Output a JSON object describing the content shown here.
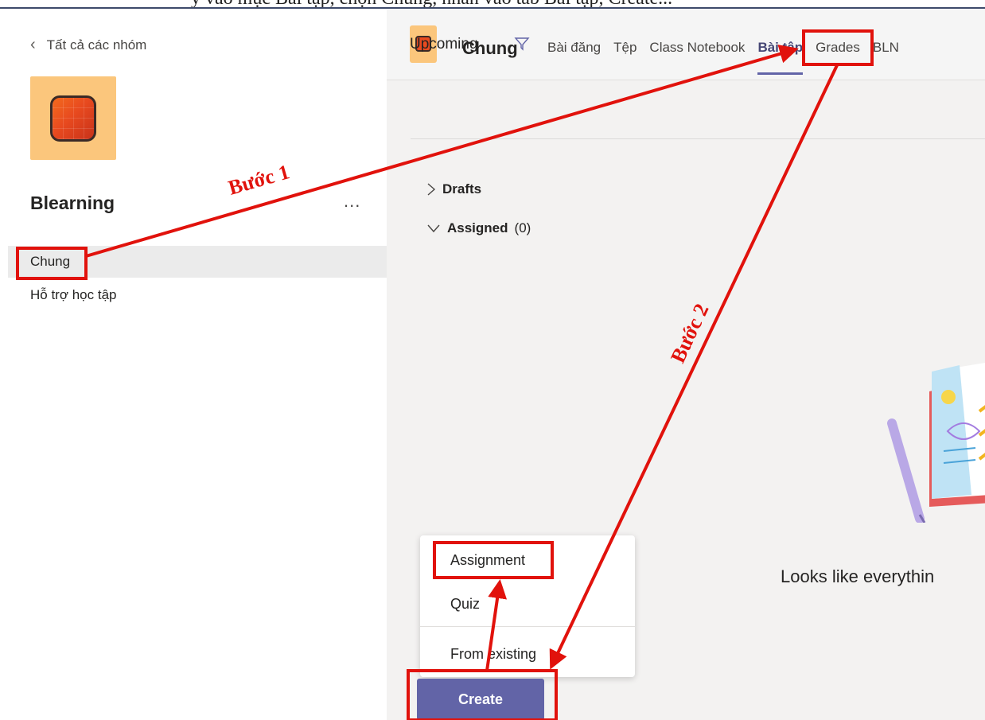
{
  "caption_fragment": "y vào mục Bài tập, chọn Chung, nhấn vào tab Bài tập, Create...",
  "sidebar": {
    "back_label": "Tất cả các nhóm",
    "team_name": "Blearning",
    "more_label": "...",
    "channels": [
      {
        "label": "Chung",
        "selected": true
      },
      {
        "label": "Hỗ trợ học tập",
        "selected": false
      }
    ]
  },
  "header": {
    "channel_title": "Chung",
    "tabs": [
      {
        "label": "Bài đăng"
      },
      {
        "label": "Tệp"
      },
      {
        "label": "Class Notebook"
      },
      {
        "label": "Bài tập",
        "active": true
      },
      {
        "label": "Grades"
      },
      {
        "label": "BLN"
      }
    ]
  },
  "filter": {
    "label": "Upcoming"
  },
  "groups": {
    "drafts": {
      "label": "Drafts"
    },
    "assigned": {
      "label": "Assigned",
      "count": "(0)"
    }
  },
  "empty_state": {
    "text": "Looks like everythin"
  },
  "create_menu": {
    "assignment": "Assignment",
    "quiz": "Quiz",
    "from_existing": "From existing"
  },
  "create_button": "Create",
  "annotations": {
    "step1": "Bước 1",
    "step2": "Bước 2",
    "color": "#e1120c"
  },
  "colors": {
    "accent": "#6264a7",
    "team_avatar_bg": "#fbc67c"
  }
}
